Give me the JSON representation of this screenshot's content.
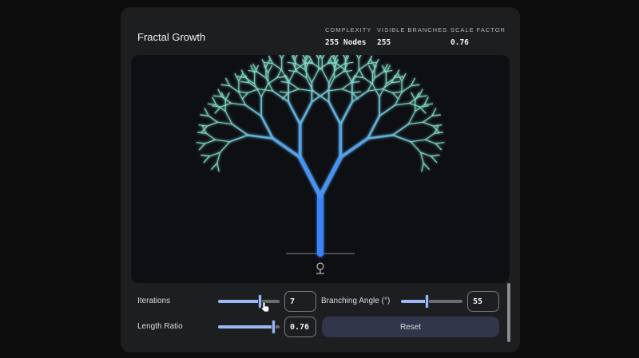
{
  "title": "Fractal Growth",
  "stats": [
    {
      "label": "COMPLEXITY",
      "value": "255 Nodes"
    },
    {
      "label": "VISIBLE BRANCHES",
      "value": "255"
    },
    {
      "label": "SCALE FACTOR",
      "value": "0.76"
    }
  ],
  "controls": {
    "iterations": {
      "label": "Iterations",
      "value": "7",
      "fraction": 0.68
    },
    "angle": {
      "label": "Branching Angle (°)",
      "value": "55",
      "fraction": 0.42
    },
    "ratio": {
      "label": "Length Ratio",
      "value": "0.76",
      "fraction": 0.9
    },
    "reset_label": "Reset"
  },
  "tree": {
    "depth": 8,
    "angle_deg": 55,
    "ratio": 0.76,
    "trunk_color": "#3b82f6",
    "tip_color": "#7fd6c4"
  },
  "icons": {
    "canvas_icon": "tree-icon",
    "cursor": "hand-pointer-icon"
  }
}
